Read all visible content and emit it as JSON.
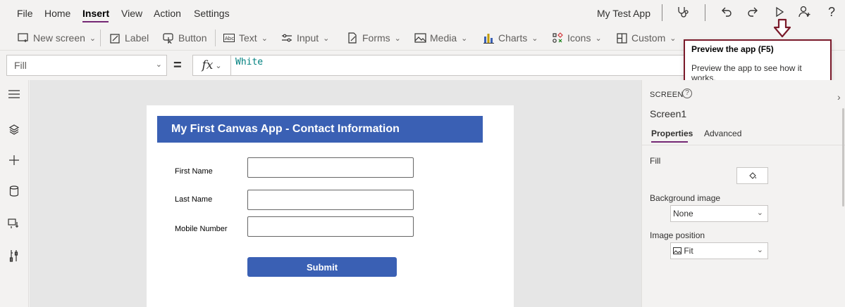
{
  "menu": {
    "items": [
      "File",
      "Home",
      "Insert",
      "View",
      "Action",
      "Settings"
    ],
    "app_name": "My Test App"
  },
  "ribbon": {
    "new_screen": "New screen",
    "label": "Label",
    "button": "Button",
    "text": "Text",
    "input": "Input",
    "forms": "Forms",
    "media": "Media",
    "charts": "Charts",
    "icons": "Icons",
    "custom": "Custom"
  },
  "formula_bar": {
    "property": "Fill",
    "fx_label": "fx",
    "formula": "White"
  },
  "tooltip": {
    "title": "Preview the app (F5)",
    "text": "Preview the app to see how it works."
  },
  "app_screen": {
    "header": "My First Canvas App - Contact Information",
    "fields": [
      "First Name",
      "Last Name",
      "Mobile Number"
    ],
    "submit": "Submit"
  },
  "right_panel": {
    "section_label": "SCREEN",
    "help": "?",
    "screen_name": "Screen1",
    "tab_properties": "Properties",
    "tab_advanced": "Advanced",
    "fill_label": "Fill",
    "background_image_label": "Background image",
    "background_image_value": "None",
    "image_position_label": "Image position",
    "image_position_value": "Fit"
  },
  "colors": {
    "accent": "#742774",
    "app_header": "#3a60b4",
    "tooltip_border": "#7a1a2a",
    "formula_text": "#00807f"
  }
}
